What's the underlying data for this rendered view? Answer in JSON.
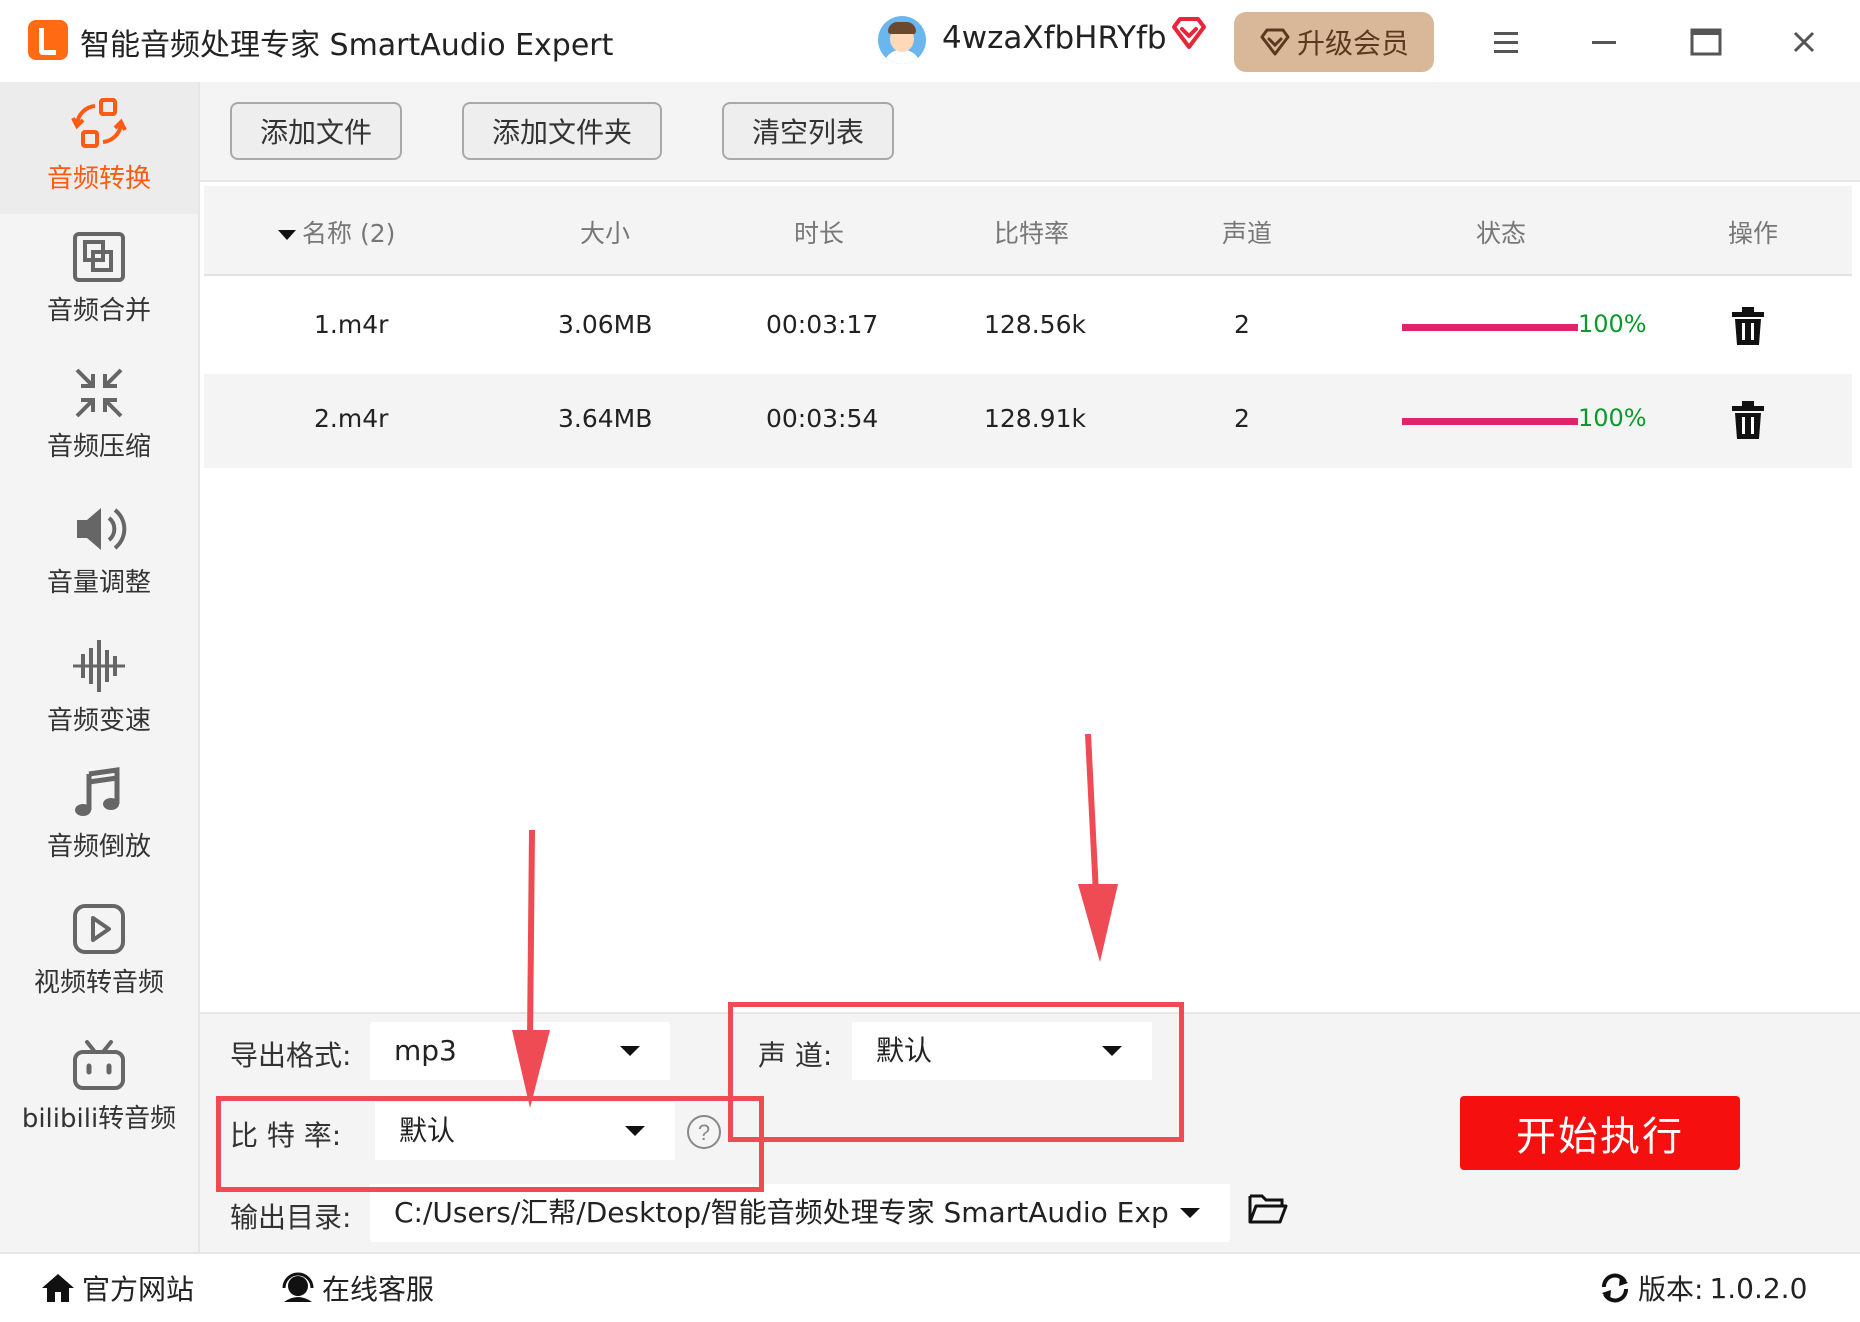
{
  "window": {
    "title": "智能音频处理专家 SmartAudio Expert",
    "username": "4wzaXfbHRYfb",
    "upgrade_label": "升级会员",
    "icons": [
      "app-logo",
      "avatar",
      "vip-diamond-icon",
      "menu-icon",
      "minimize-icon",
      "maximize-icon",
      "close-icon"
    ]
  },
  "sidebar": {
    "items": [
      {
        "label": "音频转换",
        "icon": "convert-icon",
        "active": true
      },
      {
        "label": "音频合并",
        "icon": "merge-icon"
      },
      {
        "label": "音频压缩",
        "icon": "compress-icon"
      },
      {
        "label": "音量调整",
        "icon": "volume-icon"
      },
      {
        "label": "音频变速",
        "icon": "speed-icon"
      },
      {
        "label": "音频倒放",
        "icon": "music-note-icon"
      },
      {
        "label": "视频转音频",
        "icon": "video-play-icon"
      },
      {
        "label": "bilibili转音频",
        "icon": "bilibili-icon"
      }
    ],
    "active_color": "#ff5a14"
  },
  "toolbar": {
    "add_file": "添加文件",
    "add_folder": "添加文件夹",
    "clear_list": "清空列表"
  },
  "table": {
    "columns": [
      "名称 (2)",
      "大小",
      "时长",
      "比特率",
      "声道",
      "状态",
      "操作"
    ],
    "rows": [
      {
        "name": "1.m4r",
        "size": "3.06MB",
        "duration": "00:03:17",
        "bitrate": "128.56k",
        "channels": "2",
        "progress": 1.0,
        "status": "100%"
      },
      {
        "name": "2.m4r",
        "size": "3.64MB",
        "duration": "00:03:54",
        "bitrate": "128.91k",
        "channels": "2",
        "progress": 1.0,
        "status": "100%"
      }
    ],
    "progress_color": "#e0246b",
    "status_color": "#0a9a2a"
  },
  "settings": {
    "format_label": "导出格式:",
    "format_value": "mp3",
    "channel_label": "声 道:",
    "channel_value": "默认",
    "bitrate_label": "比 特 率:",
    "bitrate_value": "默认",
    "output_label": "输出目录:",
    "output_value": "C:/Users/汇帮/Desktop/智能音频处理专家 SmartAudio Exp",
    "start_label": "开始执行",
    "start_color": "#f50f0f",
    "highlight_color": "#ef4b55"
  },
  "footer": {
    "website": "官方网站",
    "support": "在线客服",
    "version_label": "版本:",
    "version": "1.0.2.0"
  }
}
